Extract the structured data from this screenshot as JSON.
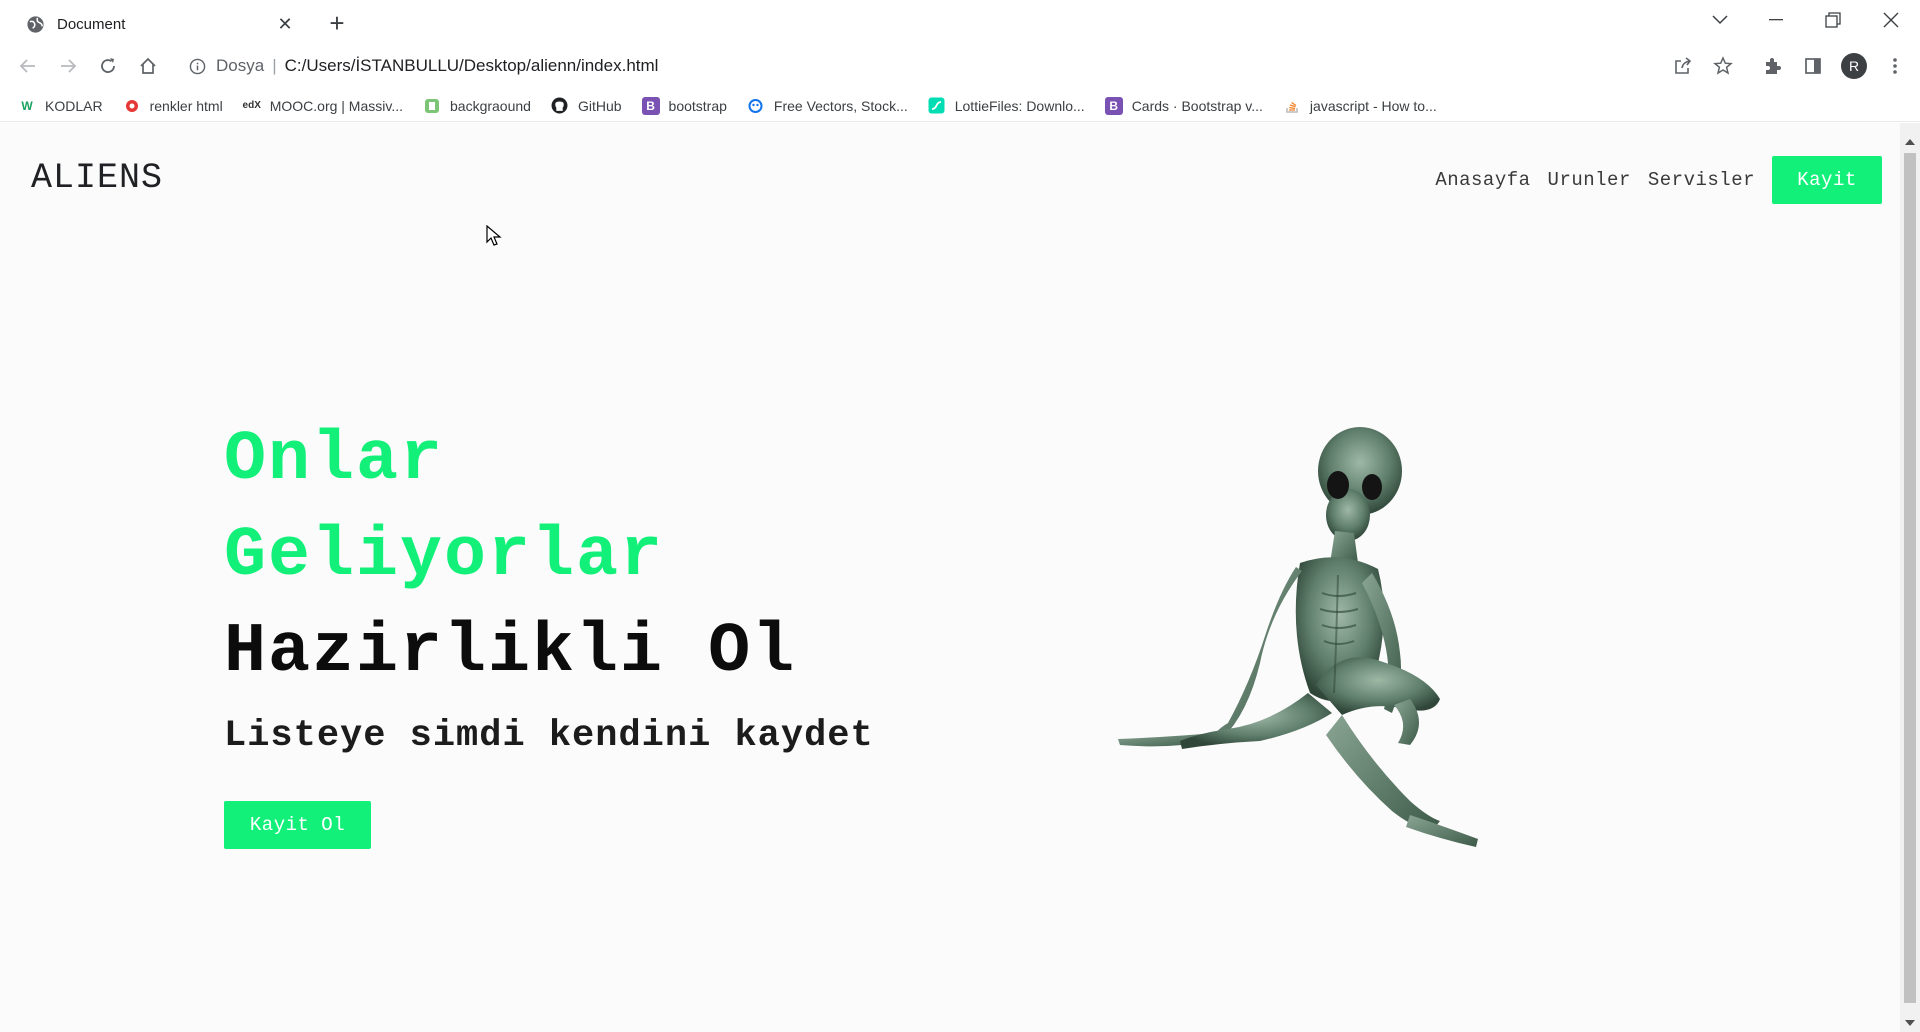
{
  "browser": {
    "tab_title": "Document",
    "address": {
      "scheme_label": "Dosya",
      "url": "C:/Users/İSTANBULLU/Desktop/alienn/index.html"
    },
    "profile_initial": "R",
    "bookmarks": [
      {
        "label": "KODLAR",
        "icon": "w-logo-icon",
        "color": "#1aa260"
      },
      {
        "label": "renkler html",
        "icon": "red-circle-icon",
        "color": "#e53935"
      },
      {
        "label": "MOOC.org | Massiv...",
        "icon": "mooc-icon",
        "color": "#333333"
      },
      {
        "label": "backgraound",
        "icon": "bg-app-icon",
        "color": "#7cc576"
      },
      {
        "label": "GitHub",
        "icon": "github-icon",
        "color": "#202124"
      },
      {
        "label": "bootstrap",
        "icon": "bootstrap-icon",
        "color": "#7952b3"
      },
      {
        "label": "Free Vectors, Stock...",
        "icon": "freepik-icon",
        "color": "#1273eb"
      },
      {
        "label": "LottieFiles: Downlo...",
        "icon": "lottie-icon",
        "color": "#00ddb3"
      },
      {
        "label": "Cards · Bootstrap v...",
        "icon": "bootstrap-icon",
        "color": "#7952b3"
      },
      {
        "label": "javascript - How to...",
        "icon": "stackoverflow-icon",
        "color": "#f48024"
      }
    ]
  },
  "site": {
    "logo": "ALIENS",
    "nav": {
      "links": [
        "Anasayfa",
        "Urunler",
        "Servisler"
      ],
      "cta": "Kayit"
    },
    "hero": {
      "line1": "Onlar",
      "line2": "Geliyorlar",
      "line3": "Hazirlikli Ol",
      "subtitle": "Listeye simdi kendini kaydet",
      "button": "Kayit Ol"
    },
    "colors": {
      "accent": "#12f07a",
      "background": "#fcfbfc",
      "text": "#0c0c0c"
    }
  }
}
